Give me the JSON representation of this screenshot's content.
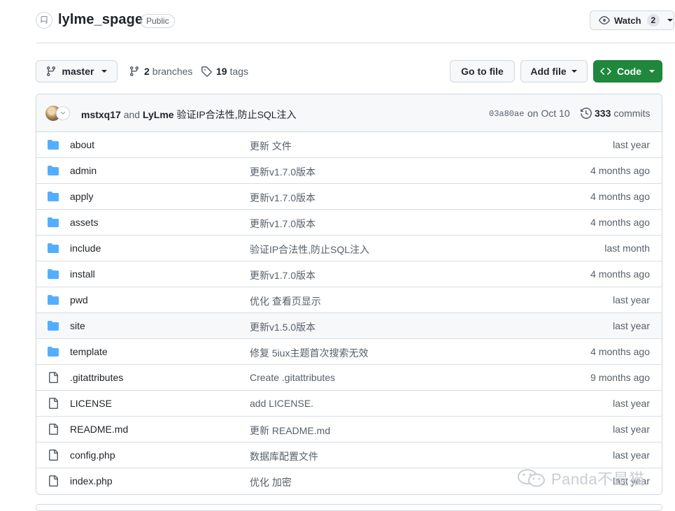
{
  "repo": {
    "name": "lylme_spage",
    "visibility": "Public",
    "watch_label": "Watch",
    "watch_count": "2"
  },
  "toolbar": {
    "branch": "master",
    "branches_count": "2",
    "branches_label": "branches",
    "tags_count": "19",
    "tags_label": "tags",
    "goto_file": "Go to file",
    "add_file": "Add file",
    "code": "Code"
  },
  "commit": {
    "author1": "mstxq17",
    "and": "and",
    "author2": "LyLme",
    "message": "验证IP合法性,防止SQL注入",
    "sha": "03a80ae",
    "date": "on Oct 10",
    "count": "333",
    "count_label": "commits"
  },
  "files": [
    {
      "type": "dir",
      "name": "about",
      "message": "更新 文件",
      "age": "last year"
    },
    {
      "type": "dir",
      "name": "admin",
      "message": "更新v1.7.0版本",
      "age": "4 months ago"
    },
    {
      "type": "dir",
      "name": "apply",
      "message": "更新v1.7.0版本",
      "age": "4 months ago"
    },
    {
      "type": "dir",
      "name": "assets",
      "message": "更新v1.7.0版本",
      "age": "4 months ago"
    },
    {
      "type": "dir",
      "name": "include",
      "message": "验证IP合法性,防止SQL注入",
      "age": "last month"
    },
    {
      "type": "dir",
      "name": "install",
      "message": "更新v1.7.0版本",
      "age": "4 months ago"
    },
    {
      "type": "dir",
      "name": "pwd",
      "message": "优化 查看页显示",
      "age": "last year"
    },
    {
      "type": "dir",
      "name": "site",
      "message": "更新v1.5.0版本",
      "age": "last year"
    },
    {
      "type": "dir",
      "name": "template",
      "message": "修复 5iux主题首次搜索无效",
      "age": "4 months ago"
    },
    {
      "type": "file",
      "name": ".gitattributes",
      "message": "Create .gitattributes",
      "age": "9 months ago"
    },
    {
      "type": "file",
      "name": "LICENSE",
      "message": "add LICENSE.",
      "age": "last year"
    },
    {
      "type": "file",
      "name": "README.md",
      "message": "更新 README.md",
      "age": "last year"
    },
    {
      "type": "file",
      "name": "config.php",
      "message": "数据库配置文件",
      "age": "last year"
    },
    {
      "type": "file",
      "name": "index.php",
      "message": "优化 加密",
      "age": "last year"
    }
  ],
  "watermark": {
    "text": "Panda不是猫"
  },
  "icons": {
    "repo": "repo-icon",
    "watch": "eye-icon",
    "branch": "git-branch-icon",
    "tag": "tag-icon",
    "code": "code-icon",
    "history": "history-icon",
    "directory": "folder-icon",
    "file": "file-icon",
    "watermark": "wechat-icon"
  },
  "colors": {
    "primary_green": "#1f883d",
    "folder_blue": "#54aeff",
    "muted_text": "#57606a",
    "border": "#d0d7de"
  }
}
